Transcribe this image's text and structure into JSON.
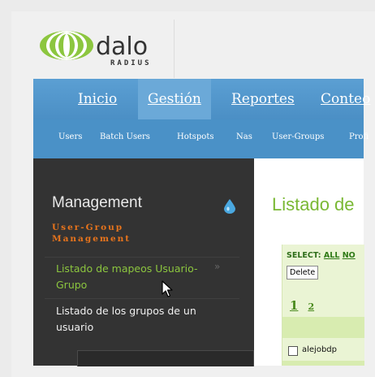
{
  "logo": {
    "main_text": "dalo",
    "sub_text": "RADIUS"
  },
  "nav": {
    "tabs": [
      {
        "label": "Inicio",
        "active": false
      },
      {
        "label": "Gestión",
        "active": true
      },
      {
        "label": "Reportes",
        "active": false
      },
      {
        "label": "Conteo",
        "active": false
      }
    ],
    "subnav": [
      "Users",
      "Batch Users",
      "Hotspots",
      "Nas",
      "User-Groups",
      "Profi"
    ]
  },
  "sidebar": {
    "title": "Management",
    "section_title": "User-Group Management",
    "items": [
      {
        "label": "Listado de mapeos Usuario-Grupo",
        "chevron": "»"
      },
      {
        "label": "Listado de los grupos de un usuario"
      }
    ],
    "search_value": ""
  },
  "main": {
    "title": "Listado de",
    "select_label": "SELECT:",
    "select_all": "ALL",
    "select_none": "NO",
    "delete_button": "Delete",
    "pages": [
      "1",
      "2"
    ],
    "rows": [
      {
        "username": "alejobdp"
      }
    ]
  },
  "colors": {
    "nav_blue": "#4a91c7",
    "sidebar_dark": "#333333",
    "accent_green": "#7ab834",
    "section_orange": "#e8741c"
  }
}
